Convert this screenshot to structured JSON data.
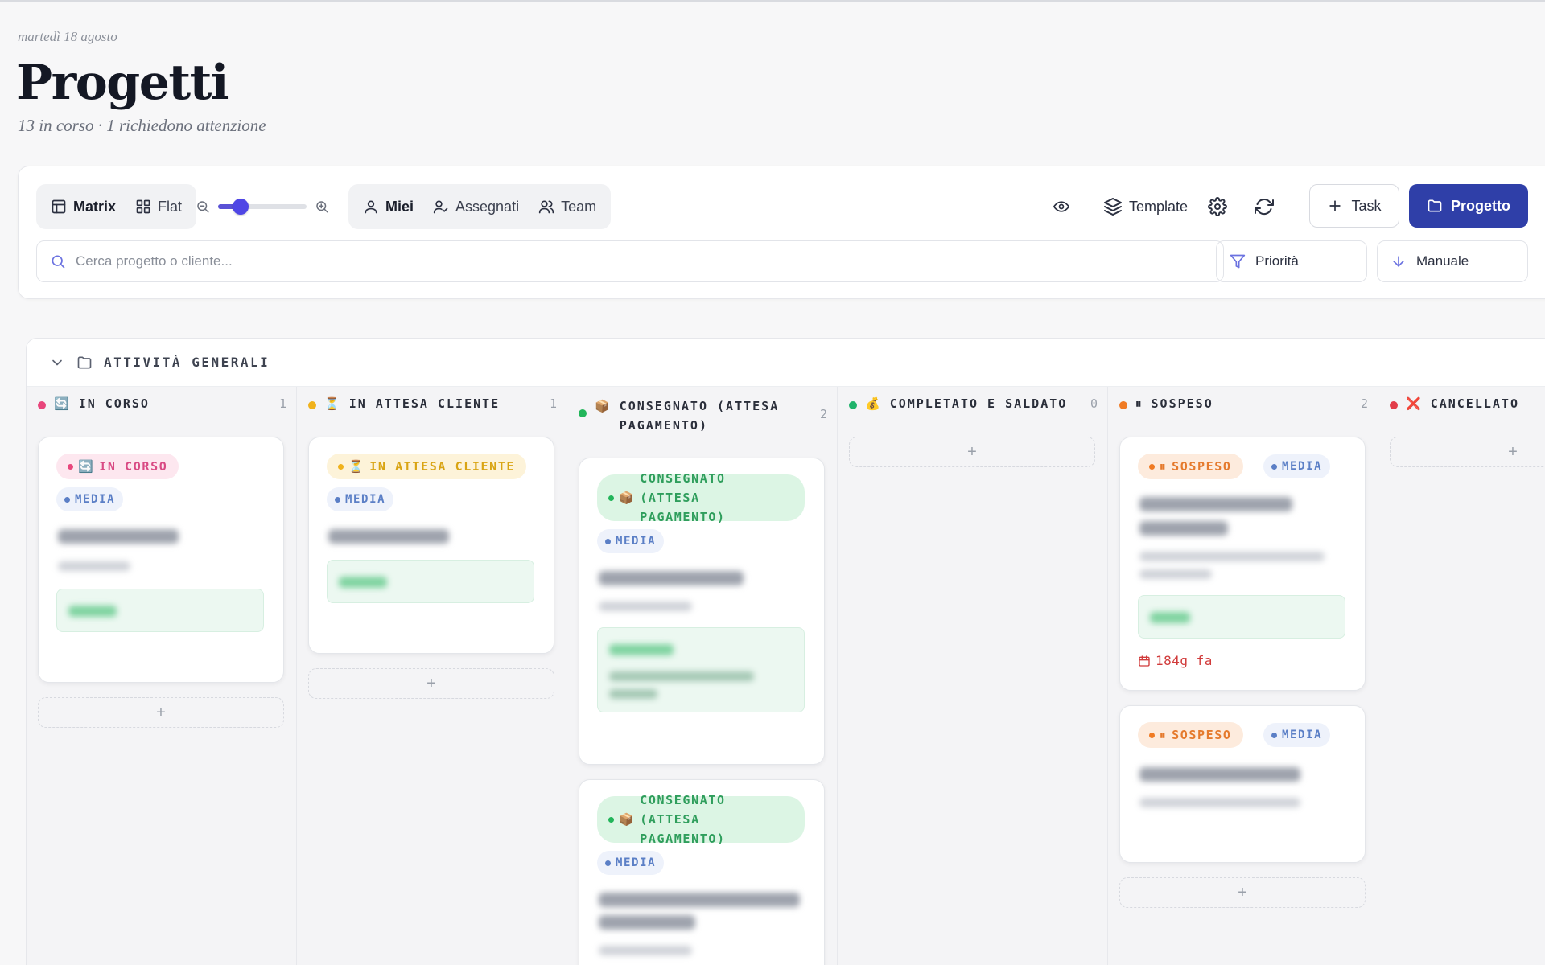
{
  "header": {
    "date": "martedì 18 agosto",
    "title": "Progetti",
    "subtitle": "13 in corso · 1 richiedono attenzione"
  },
  "toolbar": {
    "view_matrix": "Matrix",
    "view_flat": "Flat",
    "zoom_level": 0.2,
    "filter_mine": "Miei",
    "filter_assigned": "Assegnati",
    "filter_team": "Team",
    "template_label": "Template",
    "task_button": "Task",
    "project_button": "Progetto",
    "search_placeholder": "Cerca progetto o cliente...",
    "priority_label": "Priorità",
    "sort_label": "Manuale"
  },
  "board": {
    "group_title": "ATTIVITÀ GENERALI",
    "add_symbol": "+",
    "columns": [
      {
        "title": "IN CORSO",
        "count": "1",
        "icon": "🔄",
        "color": "#e8467c"
      },
      {
        "title": "IN ATTESA CLIENTE",
        "count": "1",
        "icon": "⏳",
        "color": "#f0b21c"
      },
      {
        "title": "CONSEGNATO (ATTESA PAGAMENTO)",
        "count": "2",
        "icon": "📦",
        "color": "#22b55a"
      },
      {
        "title": "COMPLETATO E SALDATO",
        "count": "0",
        "icon": "💰",
        "color": "#1fb36b"
      },
      {
        "title": "SOSPESO",
        "count": "2",
        "icon": "⏸",
        "color": "#f07b24"
      },
      {
        "title": "CANCELLATO",
        "count": "",
        "icon": "❌",
        "color": "#e23d4a"
      }
    ],
    "priority_badge": "MEDIA",
    "due_label": "184g fa"
  },
  "colors": {
    "accent": "#2f3fa8",
    "in_corso_badge_bg": "#fde7ef",
    "in_corso_badge_fg": "#d94a84",
    "attesa_badge_bg": "#fdf3d9",
    "attesa_badge_fg": "#d9a413",
    "consegnato_badge_bg": "#dcf5e4",
    "consegnato_badge_fg": "#2f9e5c",
    "sospeso_badge_bg": "#fdebdd",
    "sospeso_badge_fg": "#e57a2d"
  }
}
